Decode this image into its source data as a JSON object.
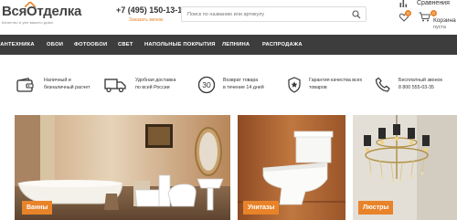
{
  "header": {
    "logo_text": "ВсяОтделка",
    "logo_tagline": "Качество и уют вашего дома",
    "phone": "+7 (495) 150-13-10",
    "callback": "Заказать звонок",
    "search_placeholder": "Поиск по названию или артикулу",
    "compare_label": "Сравнения",
    "favorites_count": "0",
    "cart_count": "0",
    "cart_label": "Корзина",
    "cart_status": "пуста"
  },
  "nav": {
    "items": [
      {
        "label": "САНТЕХНИКА"
      },
      {
        "label": "ОБОИ"
      },
      {
        "label": "ФОТООБОИ"
      },
      {
        "label": "СВЕТ"
      },
      {
        "label": "НАПОЛЬНЫЕ ПОКРЫТИЯ"
      },
      {
        "label": "ЛЕПНИНА"
      },
      {
        "label": "РАСПРОДАЖА"
      }
    ]
  },
  "features": [
    {
      "icon": "wallet-icon",
      "line1": "Наличный и",
      "line2": "безналичный расчет"
    },
    {
      "icon": "truck-icon",
      "line1": "Удобная доставка",
      "line2": "по всей России"
    },
    {
      "icon": "return-30-icon",
      "icon_text": "30",
      "line1": "Возврат товара",
      "line2": "в течение 14 дней"
    },
    {
      "icon": "star-badge-icon",
      "line1": "Гарантия качества всех",
      "line2": "товаров"
    },
    {
      "icon": "phone-icon",
      "line1": "Бесплатный звонок",
      "line2": "8 800 555-03-35"
    }
  ],
  "categories": [
    {
      "label": "Ванны"
    },
    {
      "label": "Унитазы"
    },
    {
      "label": "Люстры"
    }
  ],
  "colors": {
    "accent": "#e8832a",
    "nav_bg": "#3d3d3d"
  }
}
